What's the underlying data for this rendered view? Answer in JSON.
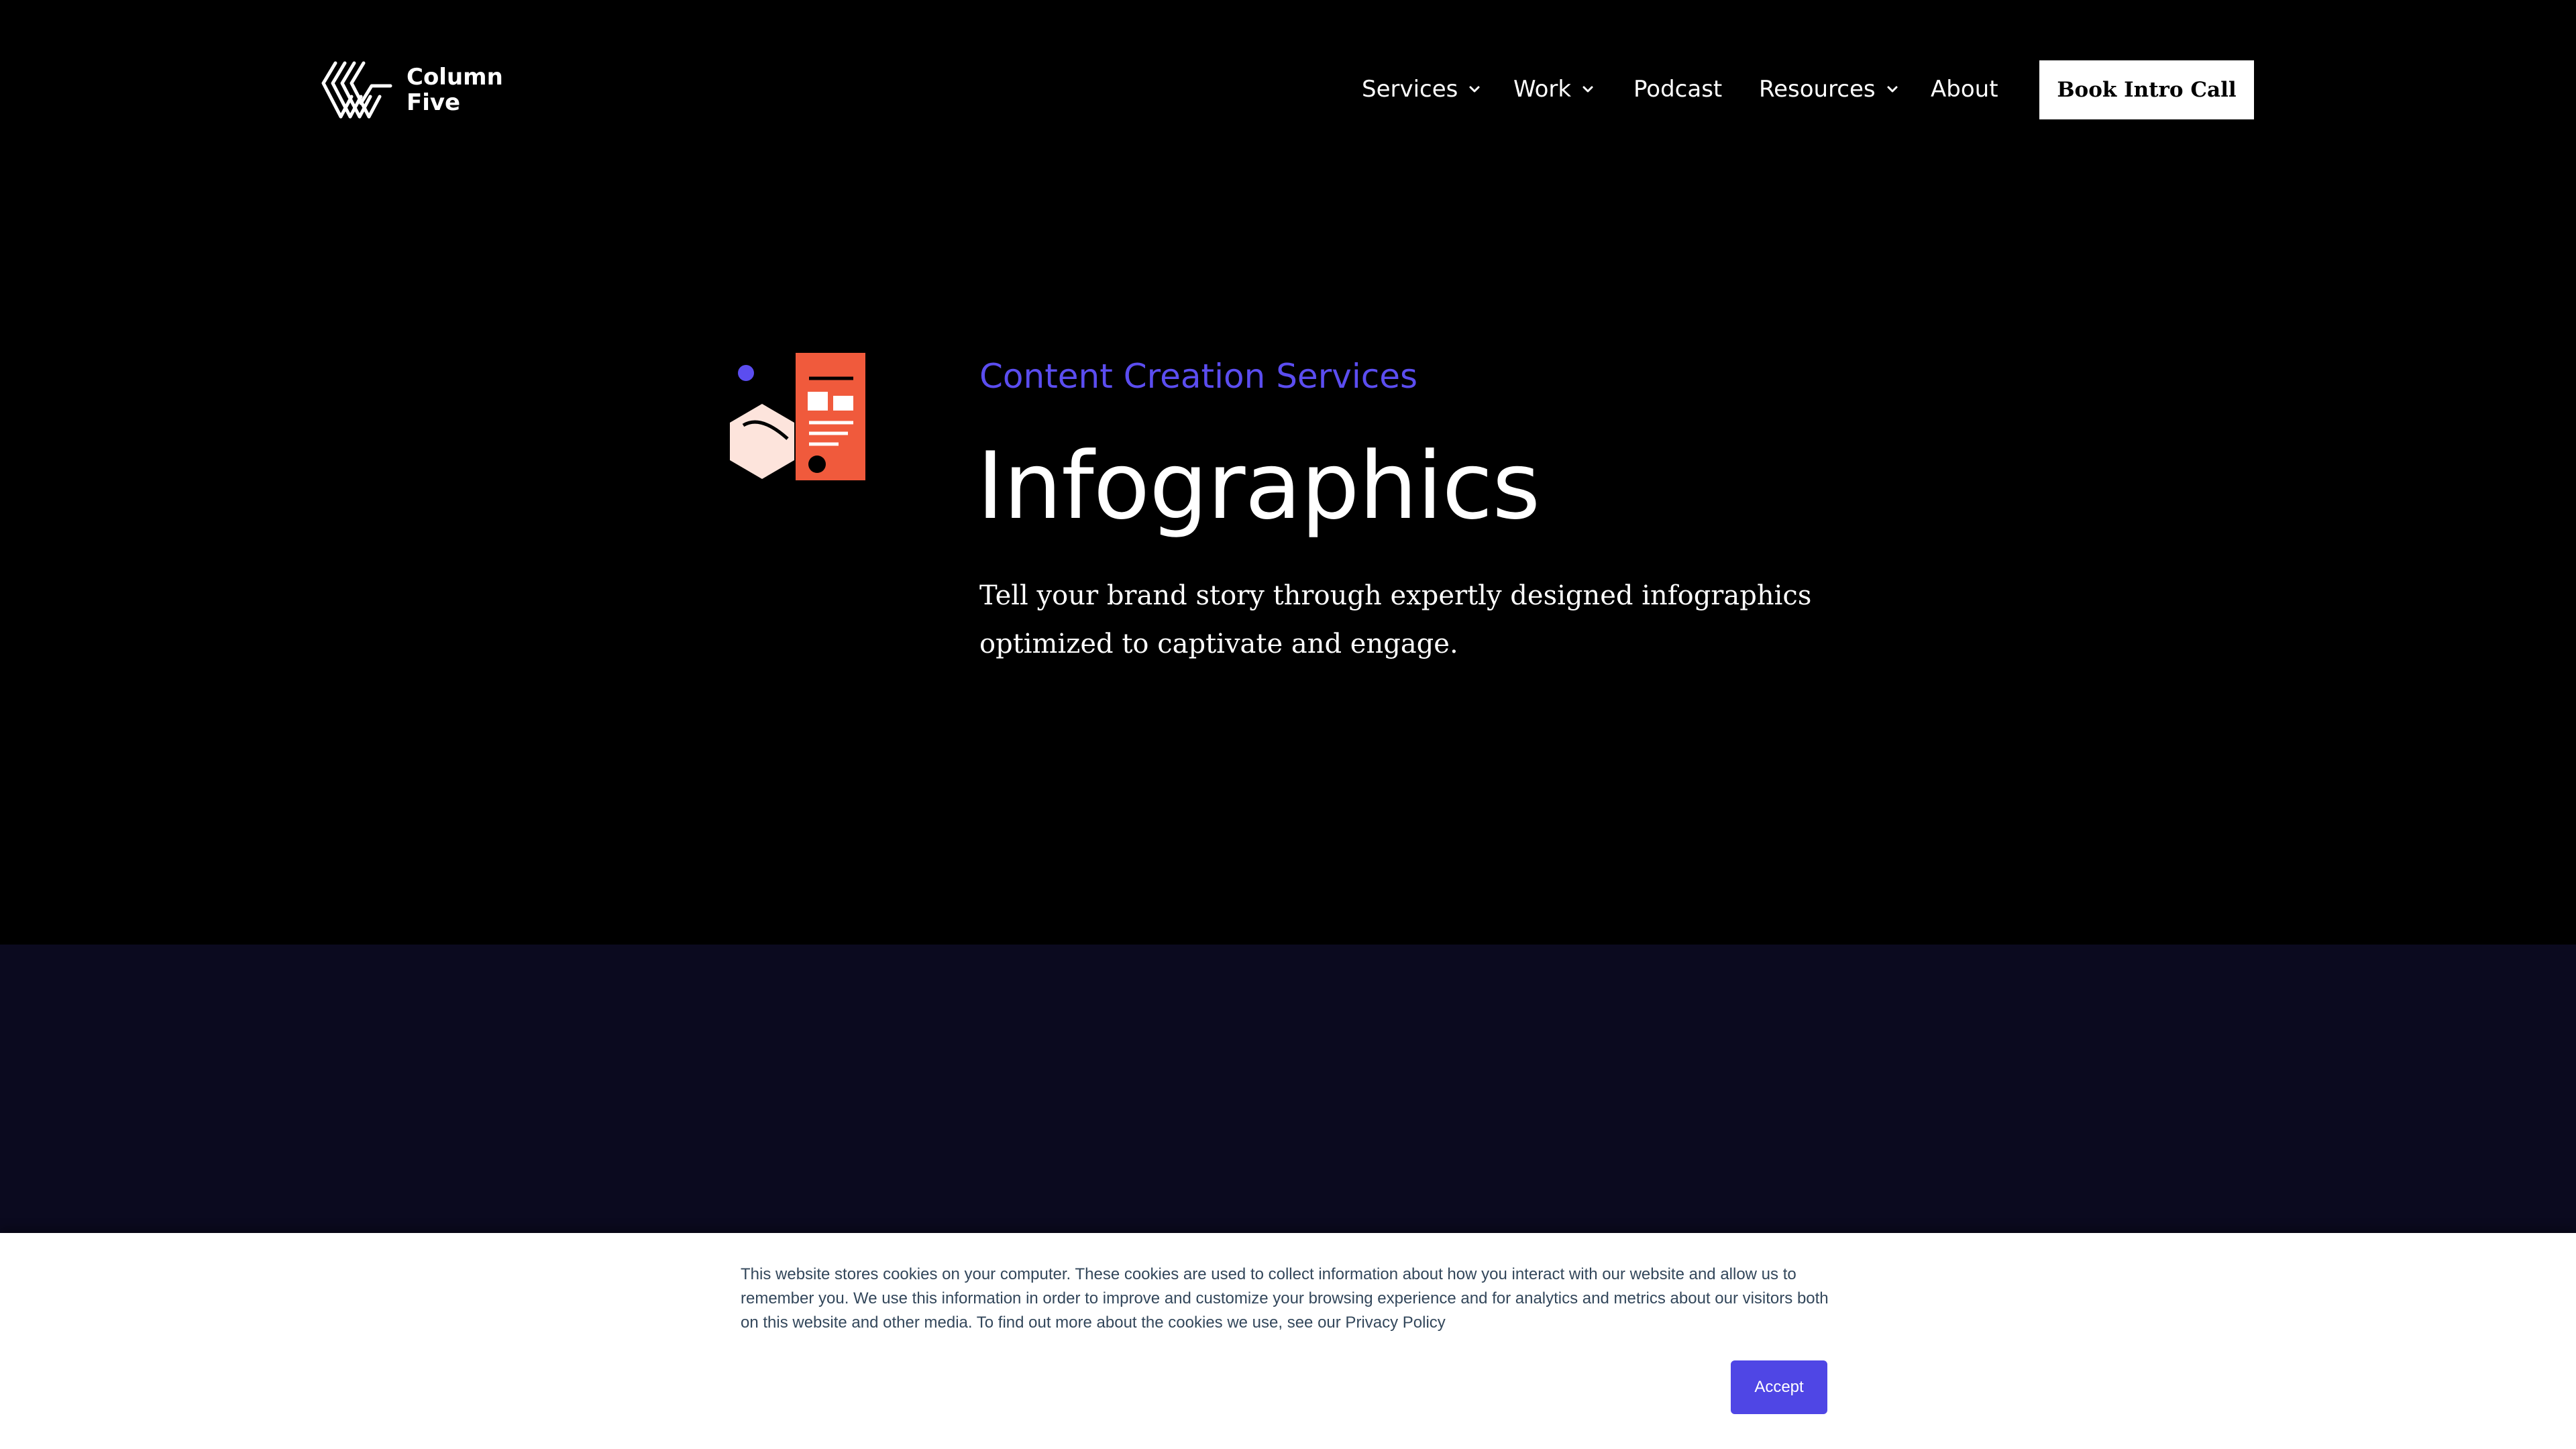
{
  "brand": {
    "name_line1": "Column",
    "name_line2": "Five",
    "accent_color": "#5b4df0",
    "icon_color": "#f05a3c"
  },
  "nav": {
    "items": [
      {
        "label": "Services",
        "has_dropdown": true
      },
      {
        "label": "Work",
        "has_dropdown": true
      },
      {
        "label": "Podcast",
        "has_dropdown": false
      },
      {
        "label": "Resources",
        "has_dropdown": true
      },
      {
        "label": "About",
        "has_dropdown": false
      }
    ],
    "cta_label": "Book Intro Call"
  },
  "hero": {
    "eyebrow": "Content Creation Services",
    "title": "Infographics",
    "description": "Tell your brand story through expertly designed infographics optimized to captivate and engage.",
    "icon": "infographic-illustration-icon"
  },
  "cookie_banner": {
    "text": "This website stores cookies on your computer. These cookies are used to collect information about how you interact with our website and allow us to remember you. We use this information in order to improve and customize your browsing experience and for analytics and metrics about our visitors both on this website and other media. To find out more about the cookies we use, see our Privacy Policy",
    "accept_label": "Accept",
    "accent_color": "#4f46e5"
  }
}
